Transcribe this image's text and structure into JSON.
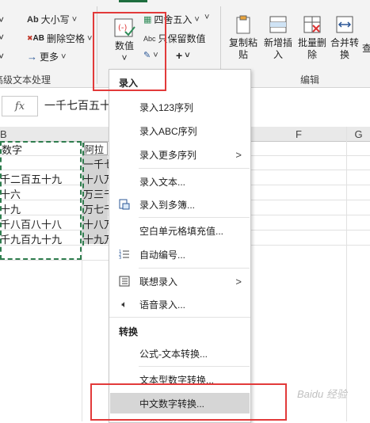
{
  "ribbon": {
    "case_label": "大小写",
    "delete_spaces_label": "删除空格",
    "more_label": "更多",
    "group_text_label": "高级文本处理",
    "value_label": "数值",
    "round_label": "四舍五入",
    "keep_values_label": "只保留数值",
    "copy_paste_label": "复制粘\n贴",
    "insert_label": "新增插\n入",
    "batch_delete_label": "批量删\n除",
    "merge_label": "合并转\n换",
    "edit_group_label": "编辑"
  },
  "formula_bar": {
    "fx": "fx",
    "content": "一千七百五十"
  },
  "columns": [
    "B",
    "F",
    "G"
  ],
  "cells": {
    "b_header": "数字",
    "c_header": "阿拉",
    "b_rows": [
      "千二百五十九",
      "十六",
      "十九",
      "千八百八十八",
      "千九百九十九"
    ],
    "c_rows": [
      "一千七",
      "十八万",
      "万三千",
      "万七千",
      "十八万",
      "十九万"
    ]
  },
  "menu": {
    "section1": "录入",
    "items1": [
      {
        "label": "录入123序列",
        "icon": ""
      },
      {
        "label": "录入ABC序列",
        "icon": ""
      },
      {
        "label": "录入更多序列",
        "icon": "",
        "arrow": ">"
      },
      {
        "label": "录入文本...",
        "icon": ""
      },
      {
        "label": "录入到多簿...",
        "icon": "book-icon"
      },
      {
        "label": "空白单元格填充值...",
        "icon": ""
      },
      {
        "label": "自动编号...",
        "icon": "numbered-list-icon"
      },
      {
        "label": "联想录入",
        "icon": "associate-icon",
        "arrow": ">"
      },
      {
        "label": "语音录入...",
        "icon": "speaker-icon"
      }
    ],
    "section2": "转换",
    "items2": [
      {
        "label": "公式-文本转换..."
      },
      {
        "label": "文本型数字转换..."
      },
      {
        "label": "中文数字转换..."
      }
    ]
  },
  "watermark": "Baidu 经验",
  "colors": {
    "accent": "#1e6e3e",
    "highlight_box": "#e23a3a",
    "menu_hover": "#d6d6d6"
  }
}
